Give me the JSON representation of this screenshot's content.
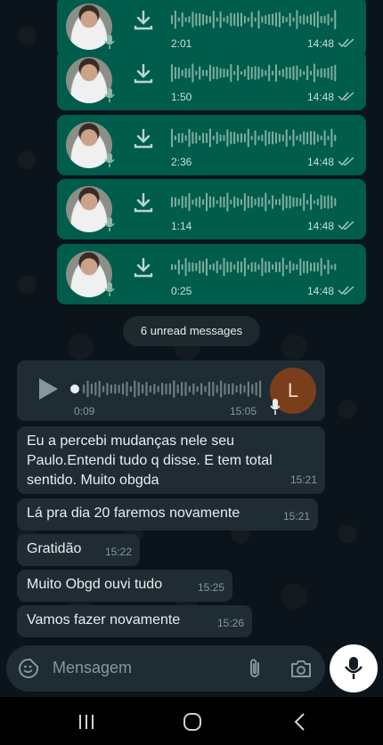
{
  "outgoing_voice": [
    {
      "duration": "2:01",
      "time": "14:48"
    },
    {
      "duration": "1:50",
      "time": "14:48"
    },
    {
      "duration": "2:36",
      "time": "14:48"
    },
    {
      "duration": "1:14",
      "time": "14:48"
    },
    {
      "duration": "0:25",
      "time": "14:48"
    }
  ],
  "unread_banner": "6 unread messages",
  "incoming_voice": {
    "current": "0:09",
    "time": "15:05",
    "avatar_letter": "L"
  },
  "messages": [
    {
      "text": "Eu a percebi mudanças nele seu Paulo.Entendi tudo q disse. E tem total sentido. Muito obgda",
      "time": "15:21"
    },
    {
      "text": "Lá pra dia 20 faremos novamente",
      "time": "15:21"
    },
    {
      "text": "Gratidão",
      "time": "15:22"
    },
    {
      "text": "Muito Obgd ouvi tudo",
      "time": "15:25"
    },
    {
      "text": "Vamos fazer novamente",
      "time": "15:26"
    }
  ],
  "composer": {
    "placeholder": "Mensagem"
  },
  "colors": {
    "outgoing_bubble": "#005c4b",
    "incoming_bubble": "#1f2c33",
    "tick_read": "#53bdeb",
    "background": "#0b141a"
  },
  "icons": [
    "download-icon",
    "mic-icon",
    "double-check-icon",
    "play-icon",
    "sticker-icon",
    "paperclip-icon",
    "camera-icon",
    "recents-icon",
    "home-icon",
    "back-icon"
  ]
}
